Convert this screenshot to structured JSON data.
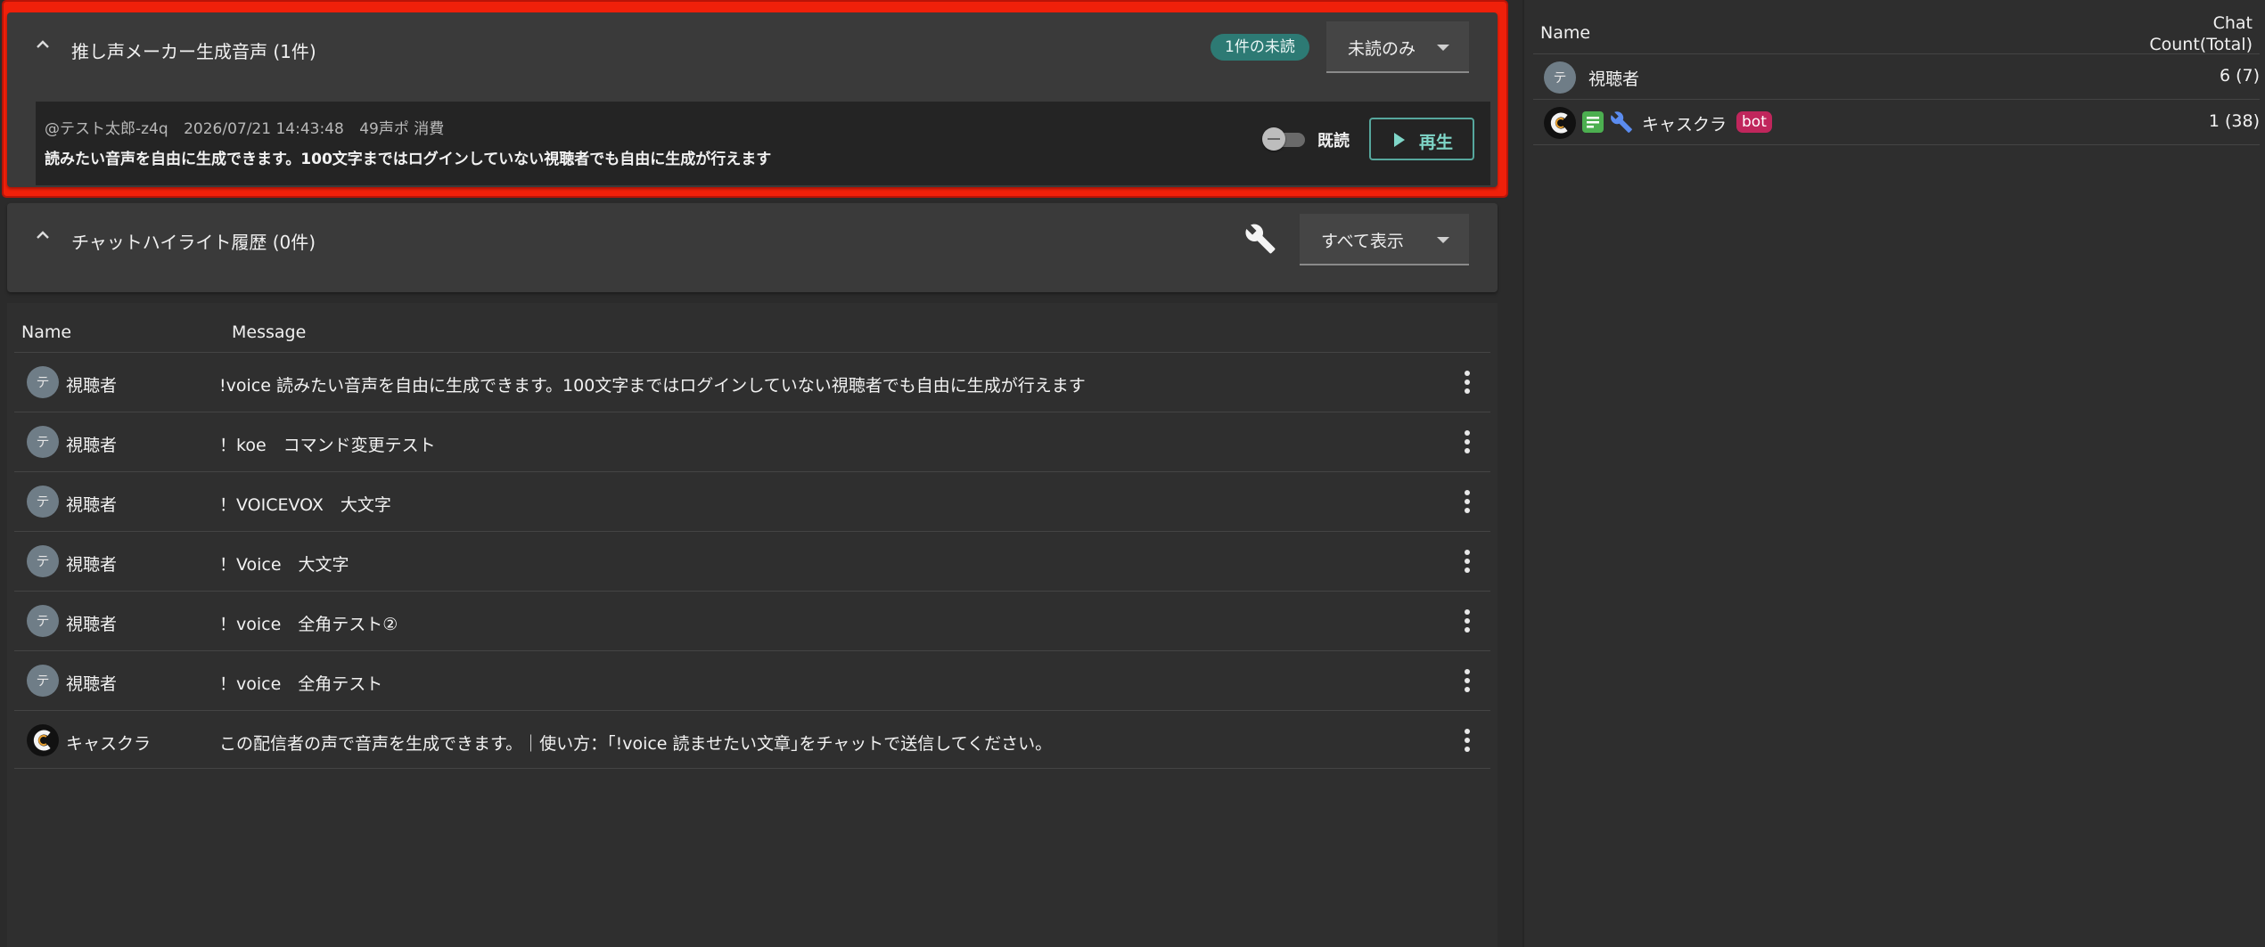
{
  "voice_panel": {
    "title": "推し声メーカー生成音声 (1件)",
    "unread_badge": "1件の未読",
    "filter_value": "未読のみ",
    "item": {
      "user": "@テスト太郎-z4q",
      "timestamp": "2026/07/21 14:43:48",
      "cost": "49声ポ 消費",
      "text": "読みたい音声を自由に生成できます。100文字まではログインしていない視聴者でも自由に生成が行えます",
      "read_toggle_label": "既読",
      "read_toggle_on": false,
      "play_label": "再生"
    }
  },
  "highlight_panel": {
    "title": "チャットハイライト履歴 (0件)",
    "filter_value": "すべて表示"
  },
  "chat_table": {
    "headers": {
      "name": "Name",
      "message": "Message"
    },
    "rows": [
      {
        "avatar": "テ",
        "name": "視聴者",
        "message": "!voice 読みたい音声を自由に生成できます。100文字まではログインしていない視聴者でも自由に生成が行えます"
      },
      {
        "avatar": "テ",
        "name": "視聴者",
        "message": "！koe　コマンド変更テスト"
      },
      {
        "avatar": "テ",
        "name": "視聴者",
        "message": "！VOICEVOX　大文字"
      },
      {
        "avatar": "テ",
        "name": "視聴者",
        "message": "！Voice　大文字"
      },
      {
        "avatar": "テ",
        "name": "視聴者",
        "message": "！voice　全角テスト②"
      },
      {
        "avatar": "テ",
        "name": "視聴者",
        "message": "！voice　全角テスト"
      },
      {
        "avatar": "C",
        "name": "キャスクラ",
        "message": "この配信者の声で音声を生成できます。｜使い方：｢!voice 読ませたい文章｣をチャットで送信してください。"
      }
    ]
  },
  "user_list": {
    "headers": {
      "name": "Name",
      "count_line1": "Chat",
      "count_line2": "Count(Total)"
    },
    "rows": [
      {
        "avatar": "テ",
        "name": "視聴者",
        "count": "6 (7)"
      },
      {
        "avatar": "C",
        "name": "キャスクラ",
        "badge": "bot",
        "count": "1 (38)"
      }
    ]
  },
  "colors": {
    "highlight_border": "#f0200a",
    "accent_teal": "#2d7a74",
    "play_green": "#7fd6c8",
    "bot_badge": "#c0265c"
  }
}
